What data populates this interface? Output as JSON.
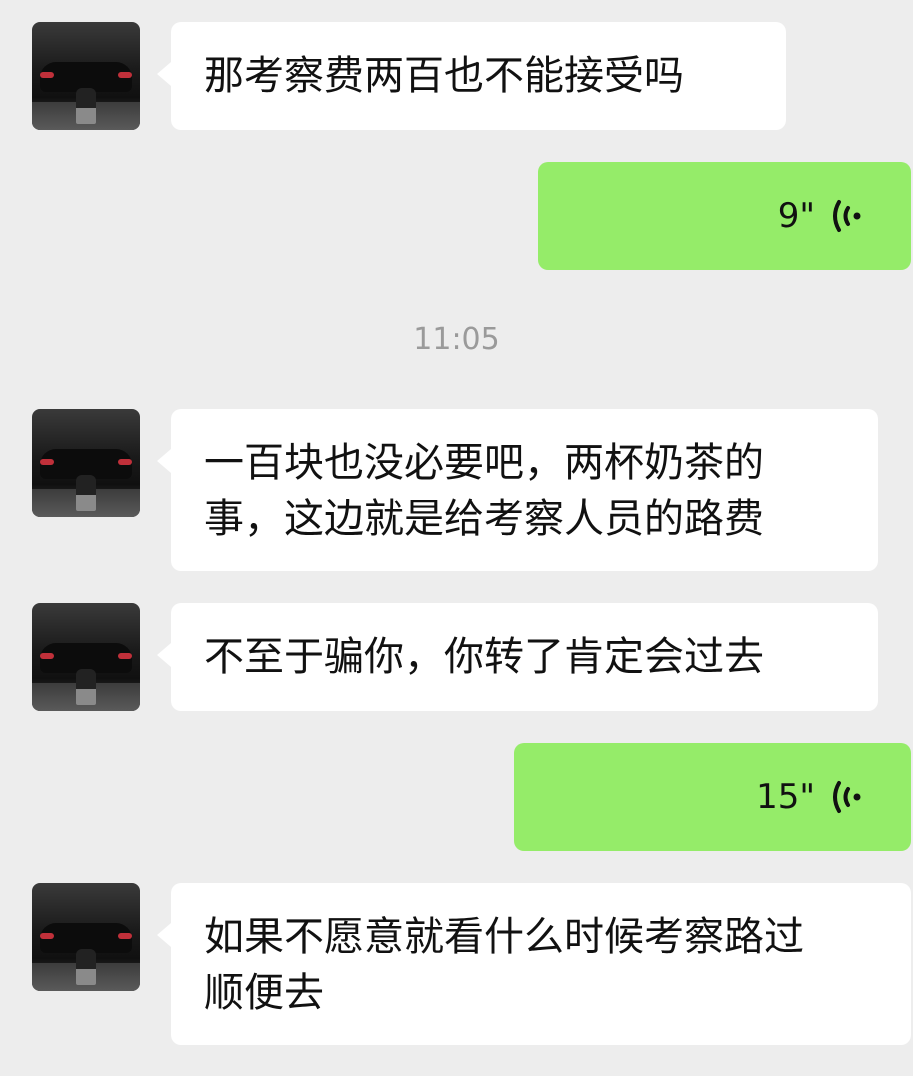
{
  "messages": [
    {
      "side": "left",
      "type": "text",
      "text": "那考察费两百也不能接受吗"
    },
    {
      "side": "right",
      "type": "voice",
      "duration": "9\""
    },
    {
      "type": "time",
      "text": "11:05"
    },
    {
      "side": "left",
      "type": "text",
      "text": "一百块也没必要吧，两杯奶茶的\n事，这边就是给考察人员的路费"
    },
    {
      "side": "left",
      "type": "text",
      "text": "不至于骗你，你转了肯定会过去"
    },
    {
      "side": "right",
      "type": "voice",
      "duration": "15\""
    },
    {
      "side": "left",
      "type": "text",
      "text": "如果不愿意就看什么时候考察路过\n顺便去"
    }
  ],
  "icons": {
    "avatar": "contact-avatar-car",
    "voice": "voice-wave-icon"
  },
  "colors": {
    "background": "#ededed",
    "incoming_bubble": "#ffffff",
    "outgoing_bubble": "#95ec69",
    "timestamp": "#9a9a9a"
  }
}
